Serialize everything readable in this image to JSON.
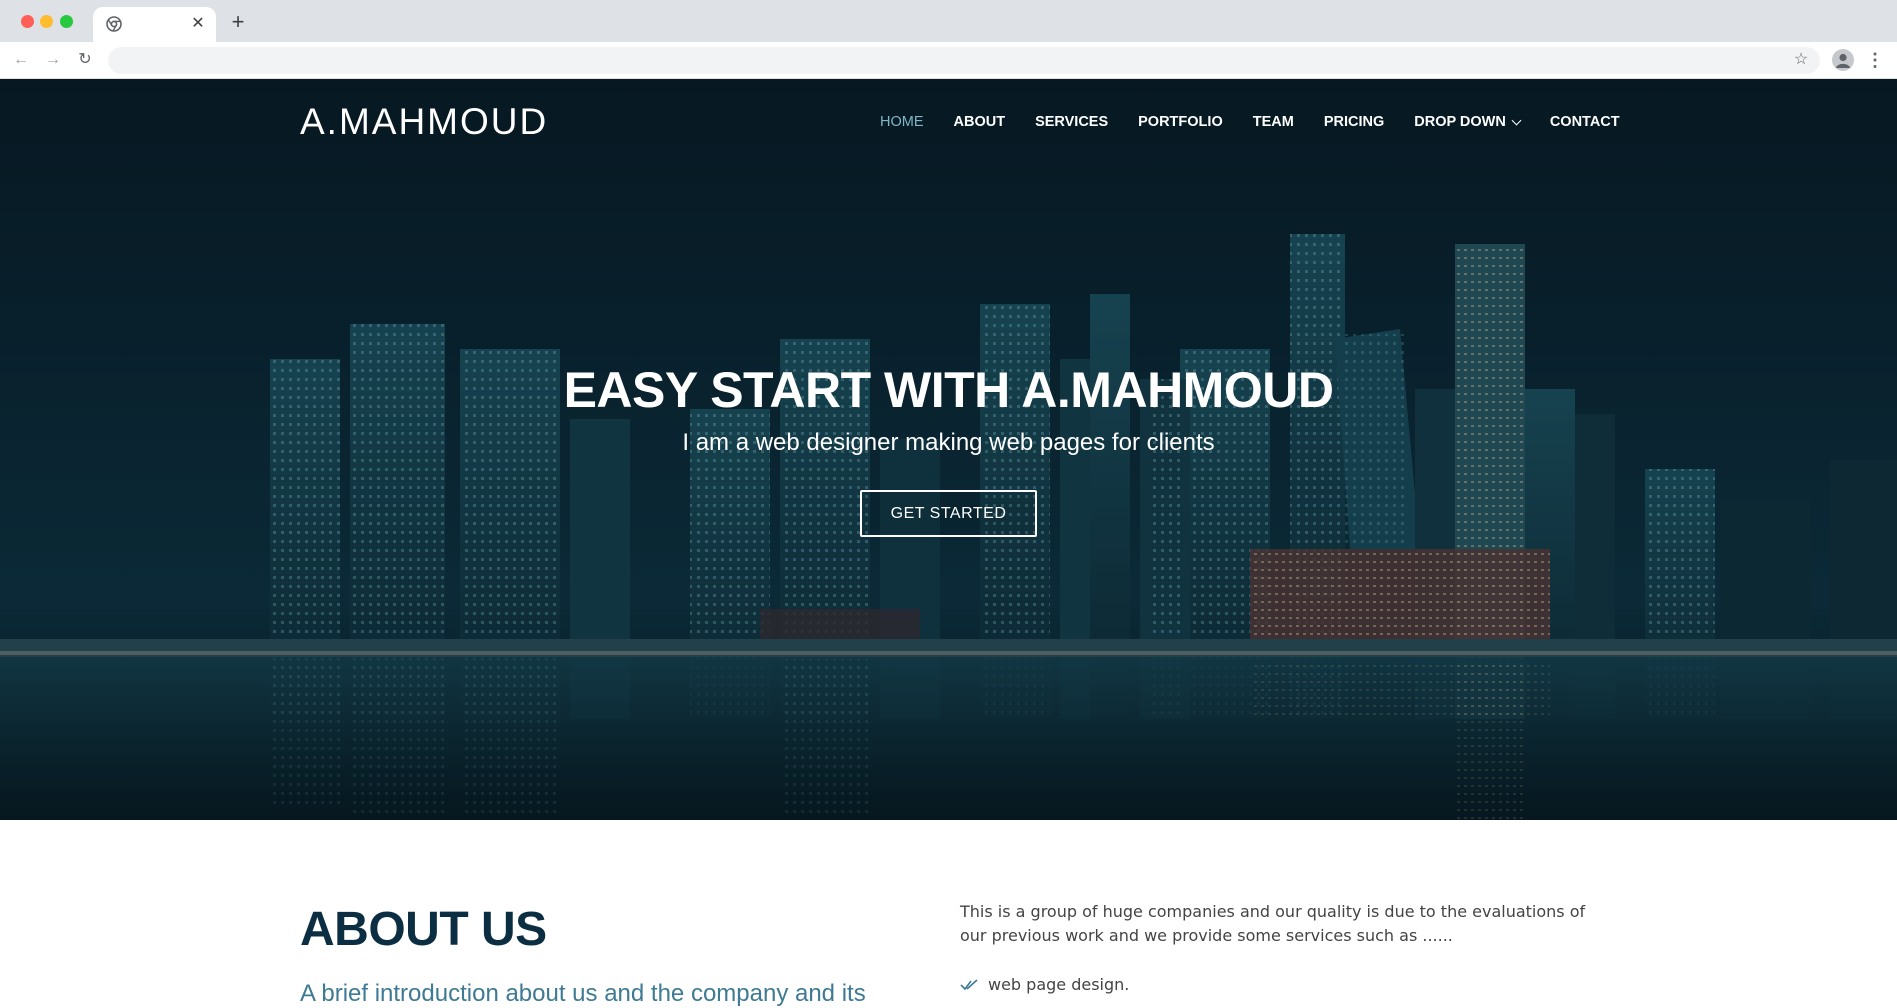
{
  "browser": {
    "tab_title": "",
    "new_tab_glyph": "+",
    "close_glyph": "✕",
    "back_glyph": "←",
    "forward_glyph": "→",
    "reload_glyph": "↻",
    "star_glyph": "☆",
    "menu_glyph": "⋮",
    "url": ""
  },
  "header": {
    "brand": "A.MAHMOUD",
    "nav": [
      {
        "label": "HOME",
        "active": true
      },
      {
        "label": "ABOUT"
      },
      {
        "label": "SERVICES"
      },
      {
        "label": "PORTFOLIO"
      },
      {
        "label": "TEAM"
      },
      {
        "label": "PRICING"
      },
      {
        "label": "DROP DOWN",
        "has_dropdown": true
      },
      {
        "label": "CONTACT"
      }
    ]
  },
  "hero": {
    "title": "EASY START WITH A.MAHMOUD",
    "subtitle": "I am a web designer making web pages for clients",
    "cta_label": "GET STARTED"
  },
  "about": {
    "title": "ABOUT US",
    "lead": "A brief introduction about us and the company and its",
    "text": "This is a group of huge companies and our quality is due to the evaluations of our previous work and we provide some services such as ......",
    "list": [
      "web page design."
    ]
  },
  "colors": {
    "hero_overlay": "#0a2230",
    "nav_active": "#7fb7c9",
    "heading_dark": "#0c2e42",
    "accent_teal": "#3e7a93"
  },
  "icons": {
    "favicon": "chrome-icon",
    "profile": "account-icon",
    "check": "double-check-icon",
    "dropdown": "chevron-down-icon"
  }
}
